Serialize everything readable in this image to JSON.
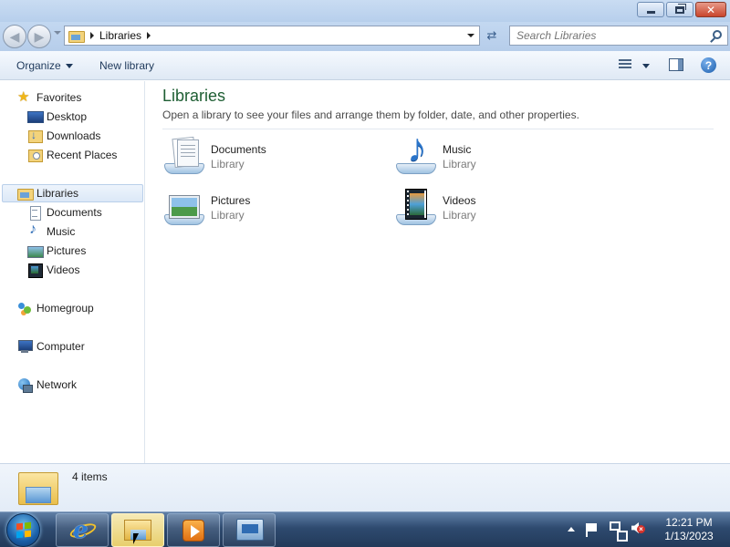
{
  "window": {
    "minimize_icon": "minimize-icon",
    "maximize_icon": "restore-icon",
    "close_label": "✕"
  },
  "address": {
    "crumbs": [
      "Libraries"
    ],
    "search_placeholder": "Search Libraries"
  },
  "toolbar": {
    "organize_label": "Organize",
    "new_library_label": "New library",
    "help_label": "?"
  },
  "nav": {
    "favorites": {
      "label": "Favorites",
      "items": [
        {
          "label": "Desktop",
          "icon": "desktop-icon"
        },
        {
          "label": "Downloads",
          "icon": "downloads-folder-icon"
        },
        {
          "label": "Recent Places",
          "icon": "recent-places-icon"
        }
      ]
    },
    "libraries": {
      "label": "Libraries",
      "items": [
        {
          "label": "Documents",
          "icon": "documents-icon"
        },
        {
          "label": "Music",
          "icon": "music-icon"
        },
        {
          "label": "Pictures",
          "icon": "pictures-icon"
        },
        {
          "label": "Videos",
          "icon": "videos-icon"
        }
      ]
    },
    "homegroup": "Homegroup",
    "computer": "Computer",
    "network": "Network"
  },
  "content": {
    "title": "Libraries",
    "description": "Open a library to see your files and arrange them by folder, date, and other properties.",
    "libraries": [
      {
        "name": "Documents",
        "type": "Library"
      },
      {
        "name": "Music",
        "type": "Library"
      },
      {
        "name": "Pictures",
        "type": "Library"
      },
      {
        "name": "Videos",
        "type": "Library"
      }
    ]
  },
  "details": {
    "count": "4 items"
  },
  "taskbar": {
    "clock_time": "12:21 PM",
    "clock_date": "1/13/2023"
  },
  "colors": {
    "title_green": "#1e5e33",
    "taskbar": "#2e4a6f",
    "selection": "#dce8f7"
  }
}
